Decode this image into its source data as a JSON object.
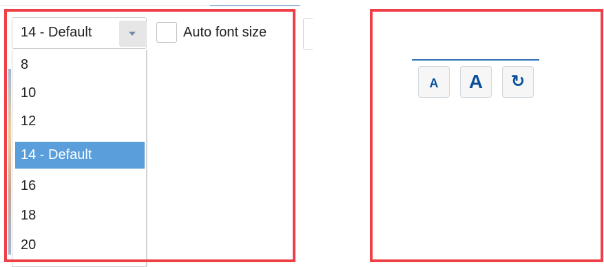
{
  "font_size_select": {
    "value": "14 - Default",
    "options": [
      "8",
      "10",
      "12",
      "14 - Default",
      "16",
      "18",
      "20"
    ],
    "selected_index": 3
  },
  "auto_font": {
    "label": "Auto font size",
    "checked": false
  },
  "font_controls": {
    "decrease_label": "A",
    "increase_label": "A",
    "reset_symbol": "↻"
  },
  "colors": {
    "highlight": "#ef3f47",
    "selection": "#5a9fdc",
    "accent": "#0b4f9b"
  }
}
